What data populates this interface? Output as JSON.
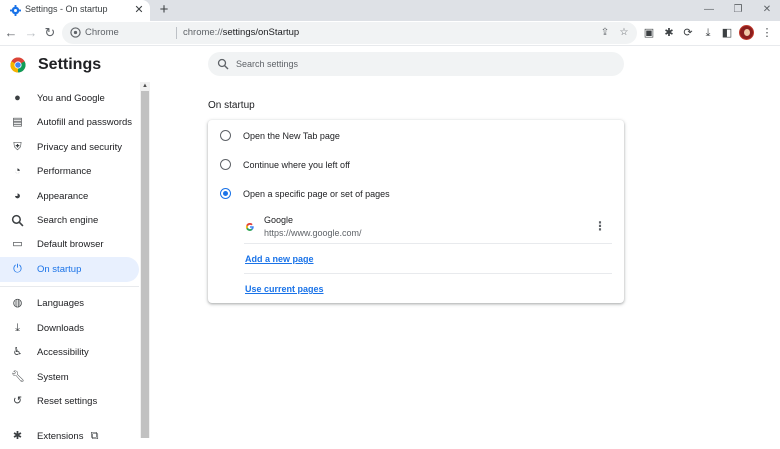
{
  "browser": {
    "tab_title": "Settings - On startup",
    "tab_close": "✕",
    "new_tab": "+",
    "omnibox_site_label": "Chrome",
    "omnibox_url_scheme": "chrome://",
    "omnibox_url_path": "settings/onStartup"
  },
  "header": {
    "title": "Settings",
    "search_placeholder": "Search settings"
  },
  "sidebar": {
    "items": [
      {
        "label": "You and Google",
        "icon": "person-icon"
      },
      {
        "label": "Autofill and passwords",
        "icon": "clipboard-icon"
      },
      {
        "label": "Privacy and security",
        "icon": "shield-icon"
      },
      {
        "label": "Performance",
        "icon": "speedometer-icon"
      },
      {
        "label": "Appearance",
        "icon": "palette-icon"
      },
      {
        "label": "Search engine",
        "icon": "search-icon"
      },
      {
        "label": "Default browser",
        "icon": "browser-window-icon"
      },
      {
        "label": "On startup",
        "icon": "power-icon",
        "active": true
      },
      {
        "label": "Languages",
        "icon": "globe-icon"
      },
      {
        "label": "Downloads",
        "icon": "download-icon"
      },
      {
        "label": "Accessibility",
        "icon": "accessibility-icon"
      },
      {
        "label": "System",
        "icon": "wrench-icon"
      },
      {
        "label": "Reset settings",
        "icon": "reset-icon"
      },
      {
        "label": "Extensions",
        "icon": "external-link-icon"
      }
    ]
  },
  "main": {
    "section_title": "On startup",
    "options": [
      {
        "label": "Open the New Tab page",
        "checked": false
      },
      {
        "label": "Continue where you left off",
        "checked": false
      },
      {
        "label": "Open a specific page or set of pages",
        "checked": true
      }
    ],
    "startup_page": {
      "name": "Google",
      "url": "https://www.google.com/"
    },
    "add_page_link": "Add a new page",
    "use_current_link": "Use current pages"
  },
  "colors": {
    "accent": "#1a73e8",
    "active_bg": "#e8f0fe",
    "tabstrip": "#dee1e6"
  }
}
